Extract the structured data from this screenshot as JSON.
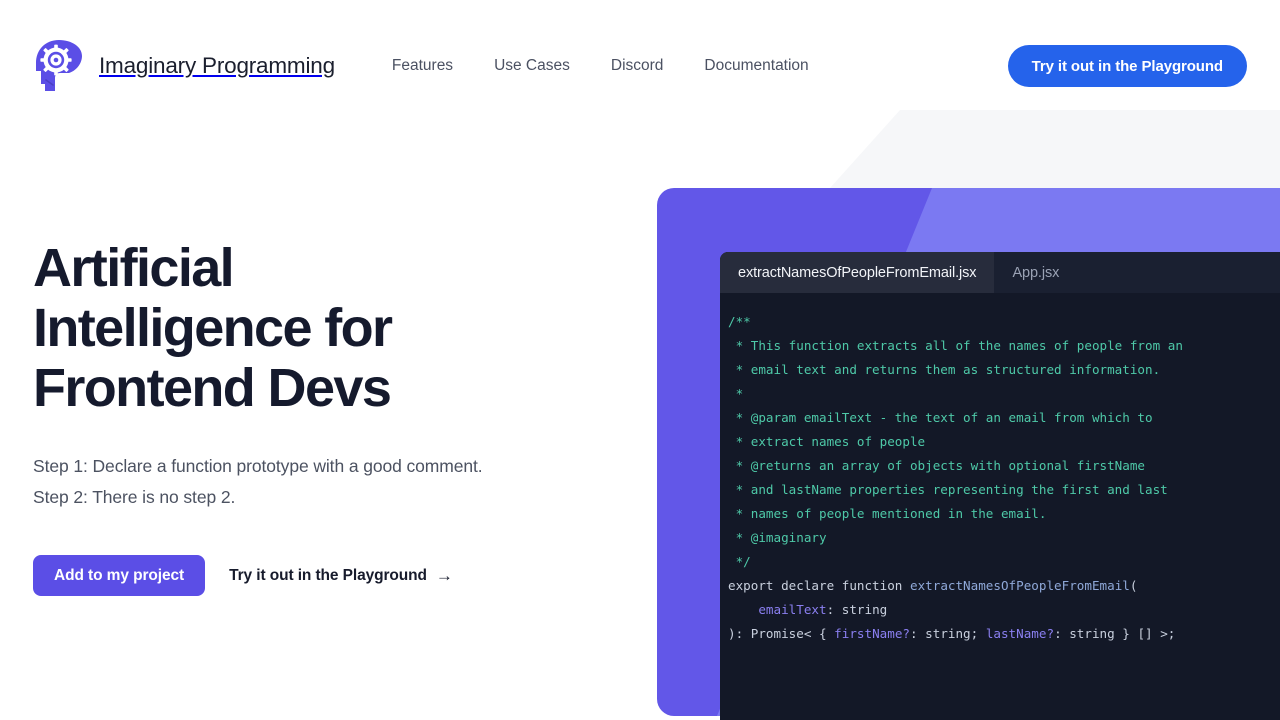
{
  "header": {
    "brand_name": "Imaginary Programming",
    "logo_icon": "brain-gear-icon",
    "nav": [
      {
        "label": "Features"
      },
      {
        "label": "Use Cases"
      },
      {
        "label": "Discord"
      },
      {
        "label": "Documentation"
      }
    ],
    "cta_label": "Try it out in the Playground",
    "cta_color": "#2563eb"
  },
  "hero": {
    "title": "Artificial Intelligence for Frontend Devs",
    "subtitle_line1": "Step 1: Declare a function prototype with a good comment.",
    "subtitle_line2": "Step 2: There is no step 2.",
    "primary_button": "Add to my project",
    "primary_button_color": "#5b4ee6",
    "secondary_link": "Try it out in the Playground",
    "secondary_link_arrow": "→"
  },
  "editor": {
    "tabs": [
      {
        "label": "extractNamesOfPeopleFromEmail.jsx",
        "active": true
      },
      {
        "label": "App.jsx",
        "active": false
      }
    ],
    "code_lines": [
      {
        "indent": 0,
        "spans": [
          {
            "text": "/**",
            "token": "comment"
          }
        ]
      },
      {
        "indent": 0,
        "spans": [
          {
            "text": " * This function extracts all of the names of people from an",
            "token": "comment"
          }
        ]
      },
      {
        "indent": 0,
        "spans": [
          {
            "text": " * email text and returns them as structured information.",
            "token": "comment"
          }
        ]
      },
      {
        "indent": 0,
        "spans": [
          {
            "text": " *",
            "token": "comment"
          }
        ]
      },
      {
        "indent": 0,
        "spans": [
          {
            "text": " * @param emailText - the text of an email from which to",
            "token": "comment"
          }
        ]
      },
      {
        "indent": 0,
        "spans": [
          {
            "text": " * extract names of people",
            "token": "comment"
          }
        ]
      },
      {
        "indent": 0,
        "spans": [
          {
            "text": " * @returns an array of objects with optional firstName",
            "token": "comment"
          }
        ]
      },
      {
        "indent": 0,
        "spans": [
          {
            "text": " * and lastName properties representing the first and last",
            "token": "comment"
          }
        ]
      },
      {
        "indent": 0,
        "spans": [
          {
            "text": " * names of people mentioned in the email.",
            "token": "comment"
          }
        ]
      },
      {
        "indent": 0,
        "spans": [
          {
            "text": " * @imaginary",
            "token": "comment"
          }
        ]
      },
      {
        "indent": 0,
        "spans": [
          {
            "text": " */",
            "token": "comment"
          }
        ]
      },
      {
        "indent": 0,
        "spans": [
          {
            "text": "export declare function ",
            "token": "kw"
          },
          {
            "text": "extractNamesOfPeopleFromEmail",
            "token": "fn"
          },
          {
            "text": "(",
            "token": "plain"
          }
        ]
      },
      {
        "indent": 0,
        "spans": [
          {
            "text": "    ",
            "token": "plain"
          },
          {
            "text": "emailText",
            "token": "param"
          },
          {
            "text": ": string",
            "token": "plain"
          }
        ]
      },
      {
        "indent": 0,
        "spans": [
          {
            "text": "): Promise< { ",
            "token": "plain"
          },
          {
            "text": "firstName?",
            "token": "param"
          },
          {
            "text": ": string; ",
            "token": "plain"
          },
          {
            "text": "lastName?",
            "token": "param"
          },
          {
            "text": ": string } [] >;",
            "token": "plain"
          }
        ]
      }
    ]
  }
}
